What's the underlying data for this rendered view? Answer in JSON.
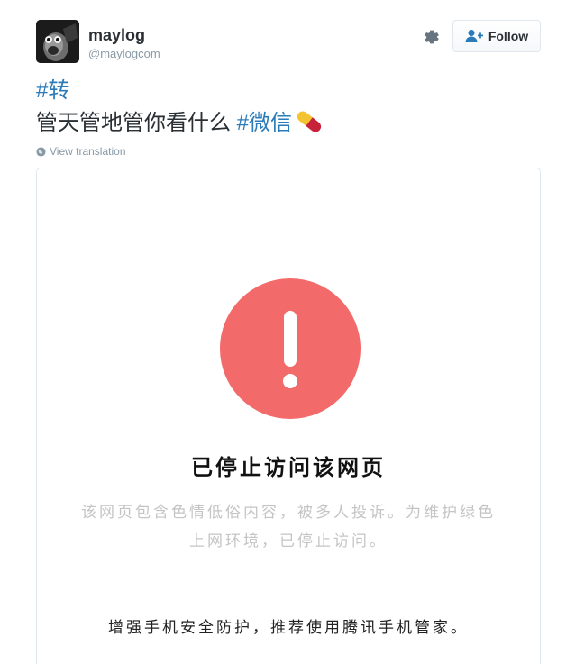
{
  "user": {
    "display_name": "maylog",
    "screen_name": "@maylogcom",
    "avatar_icon": "avatar-photo"
  },
  "actions": {
    "settings_icon": "gear-icon",
    "follow_label": "Follow",
    "follow_icon": "add-user-icon"
  },
  "tweet": {
    "hashtag_1": "#转",
    "text": "管天管地管你看什么 ",
    "hashtag_2": "#微信",
    "emoji_icon": "pill-icon",
    "translate_label": "View translation"
  },
  "card": {
    "icon": "exclamation-icon",
    "title": "已停止访问该网页",
    "desc_line1": "该网页包含色情低俗内容，被多人投诉。为维护绿色",
    "desc_line2": "上网环境，已停止访问。",
    "tip": "增强手机安全防护，推荐使用腾讯手机管家。"
  },
  "colors": {
    "hashtag": "#2b7bb9",
    "warning_red": "#f26a6a",
    "muted": "#8899a6"
  }
}
